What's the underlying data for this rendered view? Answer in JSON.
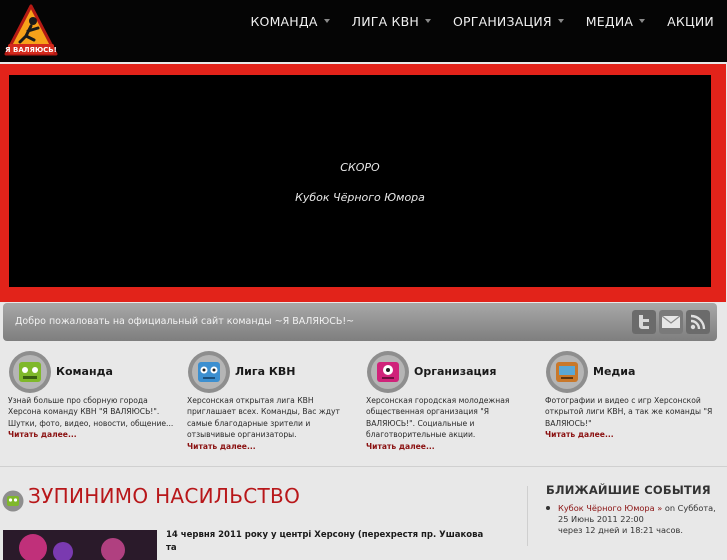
{
  "header": {
    "logo_text": "Я ВАЛЯЮСЬ!",
    "nav": [
      {
        "label": "КОМАНДА",
        "has_dropdown": true
      },
      {
        "label": "ЛИГА КВН",
        "has_dropdown": true
      },
      {
        "label": "ОРГАНИЗАЦИЯ",
        "has_dropdown": true
      },
      {
        "label": "МЕДИА",
        "has_dropdown": true
      },
      {
        "label": "АКЦИИ",
        "has_dropdown": false
      }
    ]
  },
  "slider": {
    "line1": "СКОРО",
    "line2": "Кубок Чёрного Юмора"
  },
  "welcome": {
    "text": "Добро пожаловать на официальный сайт команды ~Я ВАЛЯЮСЬ!~",
    "social_icons": [
      "twitter-icon",
      "email-icon",
      "rss-icon"
    ]
  },
  "features": [
    {
      "title": "Команда",
      "icon": "robot-green-icon",
      "desc": "Узнай больше про сборную города Херсона команду КВН \"Я ВАЛЯЮСЬ!\". Шутки, фото, видео, новости, общение...",
      "more": "Читать далее..."
    },
    {
      "title": "Лига КВН",
      "icon": "robot-blue-icon",
      "desc": "Херсонская открытая лига КВН приглашает всех. Команды, Вас ждут самые благодарные зрители и отзывчивые организаторы.",
      "more": "Читать далее..."
    },
    {
      "title": "Организация",
      "icon": "robot-pink-icon",
      "desc": "Херсонская городская молодежная общественная организация \"Я ВАЛЯЮСЬ!\". Социальные и благотворительные акции.",
      "more": "Читать далее..."
    },
    {
      "title": "Медиа",
      "icon": "robot-orange-icon",
      "desc": "Фотографии и видео с игр Херсонской открытой лиги КВН, а так же команды \"Я ВАЛЯЮСЬ!\"",
      "more": "Читать далее..."
    }
  ],
  "main": {
    "section_title": "ЗУПИНИМО НАСИЛЬСТВО",
    "article_text": "14 червня 2011 року у центрі Херсону (перехрестя пр. Ушакова та"
  },
  "sidebar": {
    "title": "БЛИЖАЙШИЕ СОБЫТИЯ",
    "events": [
      {
        "link": "Кубок Чёрного Юмора »",
        "date": "on Суббота, 25 Июнь 2011 22:00",
        "countdown": "через 12 дней и 18:21 часов."
      }
    ]
  },
  "colors": {
    "accent_red": "#e2231a",
    "title_red": "#b8171a",
    "link_red": "#8a1010"
  }
}
